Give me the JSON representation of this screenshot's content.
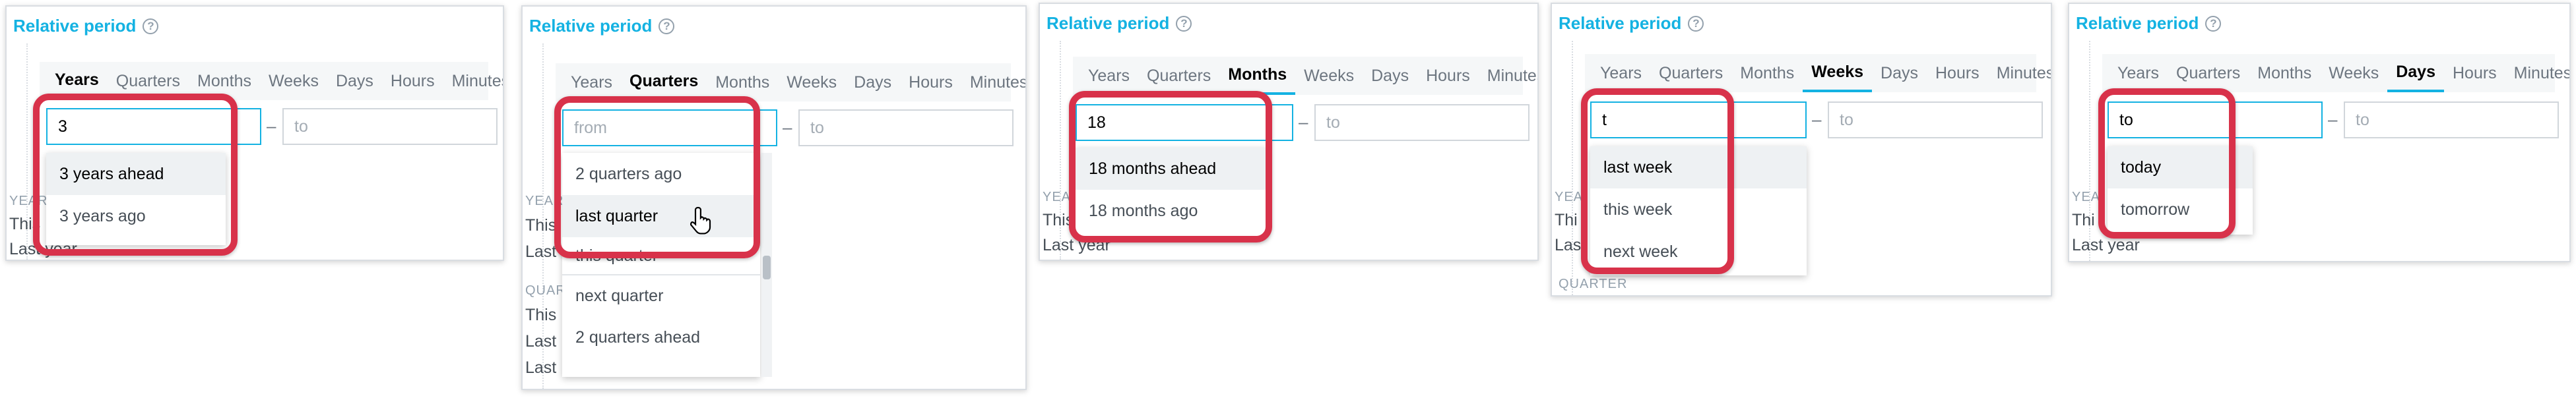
{
  "panels": [
    {
      "title": "Relative period",
      "tabs": [
        "Years",
        "Quarters",
        "Months",
        "Weeks",
        "Days",
        "Hours",
        "Minutes"
      ],
      "active_tab": 0,
      "from_value": "3",
      "from_placeholder": "",
      "to_placeholder": "to",
      "options": [
        "3 years ahead",
        "3 years ago"
      ],
      "highlighted_option": 0,
      "background": {
        "section": "YEAR",
        "items": [
          "This",
          "Last year"
        ]
      }
    },
    {
      "title": "Relative period",
      "tabs": [
        "Years",
        "Quarters",
        "Months",
        "Weeks",
        "Days",
        "Hours",
        "Minutes"
      ],
      "active_tab": 1,
      "from_value": "",
      "from_placeholder": "from",
      "to_placeholder": "to",
      "options": [
        "2 quarters ago",
        "last quarter",
        "this quarter",
        "next quarter",
        "2 quarters ahead"
      ],
      "highlighted_option": 1,
      "background": {
        "section": "YEAR",
        "items": [
          "This",
          "Last"
        ],
        "section2": "QUAR",
        "items2": [
          "This",
          "Last",
          "Last"
        ]
      }
    },
    {
      "title": "Relative period",
      "tabs": [
        "Years",
        "Quarters",
        "Months",
        "Weeks",
        "Days",
        "Hours",
        "Minutes"
      ],
      "active_tab": 2,
      "from_value": "18",
      "from_placeholder": "",
      "to_placeholder": "to",
      "options": [
        "18 months ahead",
        "18 months ago"
      ],
      "highlighted_option": 0,
      "background": {
        "section": "YEA",
        "items": [
          "This",
          "Last year"
        ]
      }
    },
    {
      "title": "Relative period",
      "tabs": [
        "Years",
        "Quarters",
        "Months",
        "Weeks",
        "Days",
        "Hours",
        "Minutes"
      ],
      "active_tab": 3,
      "from_value": "t",
      "from_placeholder": "",
      "to_placeholder": "to",
      "options": [
        "last week",
        "this week",
        "next week"
      ],
      "highlighted_option": 0,
      "background": {
        "section": "YEA",
        "items": [
          "Thi",
          "Las"
        ],
        "section2": "QUARTER"
      }
    },
    {
      "title": "Relative period",
      "tabs": [
        "Years",
        "Quarters",
        "Months",
        "Weeks",
        "Days",
        "Hours",
        "Minutes"
      ],
      "active_tab": 4,
      "from_value": "to",
      "from_placeholder": "",
      "to_placeholder": "to",
      "options": [
        "today",
        "tomorrow"
      ],
      "highlighted_option": 0,
      "background": {
        "section": "YEA",
        "items": [
          "Thi",
          "Last year"
        ]
      }
    }
  ],
  "icons": {
    "help": "help-circle-icon",
    "cursor": "hand-pointer-icon"
  },
  "colors": {
    "accent": "#14b2e2",
    "highlight_box": "#d8324a"
  }
}
